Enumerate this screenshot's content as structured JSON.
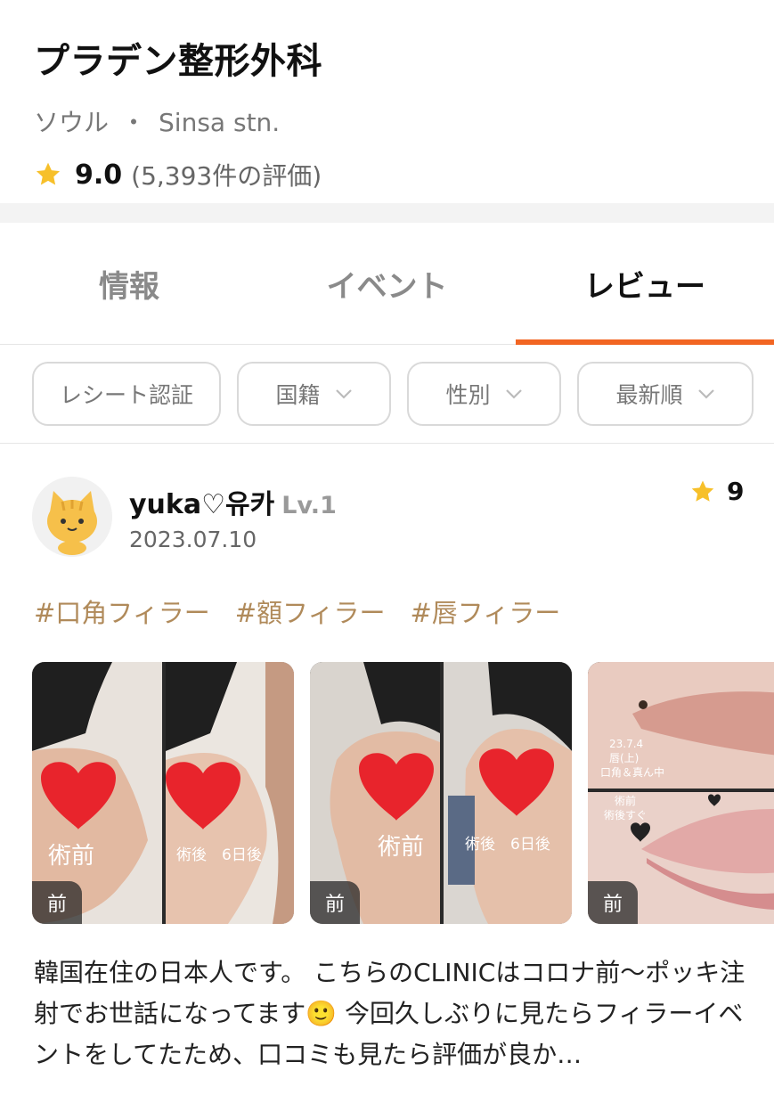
{
  "clinic": {
    "name": "プラデン整形外科",
    "city": "ソウル",
    "separator": "・",
    "station": "Sinsa stn.",
    "rating": "9.0",
    "review_count": "(5,393件の評価)"
  },
  "tabs": [
    {
      "label": "情報",
      "active": false
    },
    {
      "label": "イベント",
      "active": false
    },
    {
      "label": "レビュー",
      "active": true
    }
  ],
  "filters": {
    "receipt": "レシート認証",
    "nationality": "国籍",
    "gender": "性別",
    "sort": "最新順"
  },
  "review": {
    "user_name": "yuka♡유카",
    "level": "Lv.1",
    "date": "2023.07.10",
    "rating": "9",
    "tags": [
      "#口角フィラー",
      "#額フィラー",
      "#唇フィラー"
    ],
    "photos": [
      {
        "before_label": "術前",
        "after_label": "術後　6日後",
        "badge": "前"
      },
      {
        "before_label": "術前",
        "after_label": "術後　6日後",
        "badge": "前"
      },
      {
        "top_label_1": "23.7.4",
        "top_label_2": "唇(上)",
        "top_label_3": "口角＆真ん中",
        "bottom_label_1": "術前",
        "bottom_label_2": "術後すぐ",
        "badge": "前"
      }
    ],
    "text": "韓国在住の日本人です。 こちらのCLINICはコロナ前〜ポッキ注射でお世話になってます🙂 今回久しぶりに見たらフィラーイベントをしてたため、口コミも見たら評価が良か…"
  },
  "colors": {
    "accent": "#f26522",
    "star": "#f7c02a",
    "tag": "#b08a5a"
  },
  "icons": {
    "rating_star": "star-icon",
    "dropdown": "chevron-down-icon",
    "avatar": "cat-avatar-icon",
    "heart": "heart-sticker-icon"
  }
}
